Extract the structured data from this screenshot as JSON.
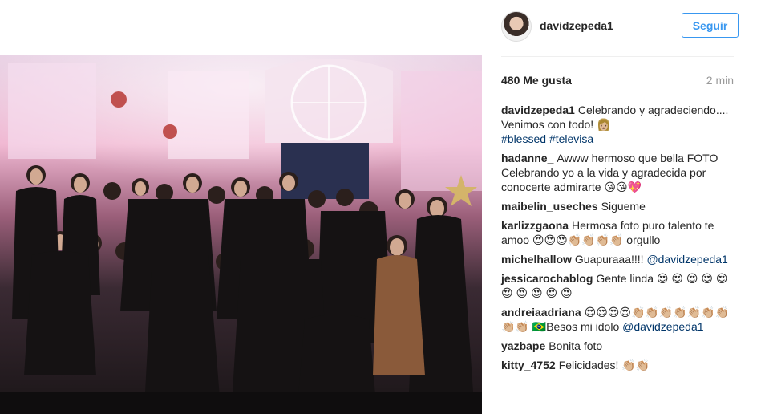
{
  "post": {
    "username": "davidzepeda1",
    "follow_label": "Seguir",
    "likes": "480 Me gusta",
    "time": "2 min"
  },
  "comments": [
    {
      "user": "davidzepeda1",
      "text": "Celebrando y agradeciendo.... Venimos con todo! 👩🏼",
      "tags": [
        "#blessed",
        "#televisa"
      ]
    },
    {
      "user": "hadanne_",
      "text": "Awww hermoso que bella FOTO Celebrando yo a la vida y agradecida por conocerte admirarte 😘😘💖"
    },
    {
      "user": "maibelin_useches",
      "text": "Sigueme"
    },
    {
      "user": "karlizzgaona",
      "text": "Hermosa foto puro talento te amoo 😍😍😍👏🏼👏🏼👏🏼👏🏼 orgullo"
    },
    {
      "user": "michelhallow",
      "text": "Guapuraaa!!!!",
      "mention": "@davidzepeda1"
    },
    {
      "user": "jessicarochablog",
      "text": "Gente linda 😍 😍 😍 😍 😍 😍 😍 😍 😍 😍"
    },
    {
      "user": "andreiaadriana",
      "text": "😍😍😍😍👏🏼👏🏼👏🏼👏🏼👏🏼👏🏼👏🏼👏🏼👏🏼 🇧🇷Besos mi idolo",
      "mention": "@davidzepeda1"
    },
    {
      "user": "yazbape",
      "text": "Bonita foto"
    },
    {
      "user": "kitty_4752",
      "text": "Felicidades! 👏🏼👏🏼"
    }
  ]
}
